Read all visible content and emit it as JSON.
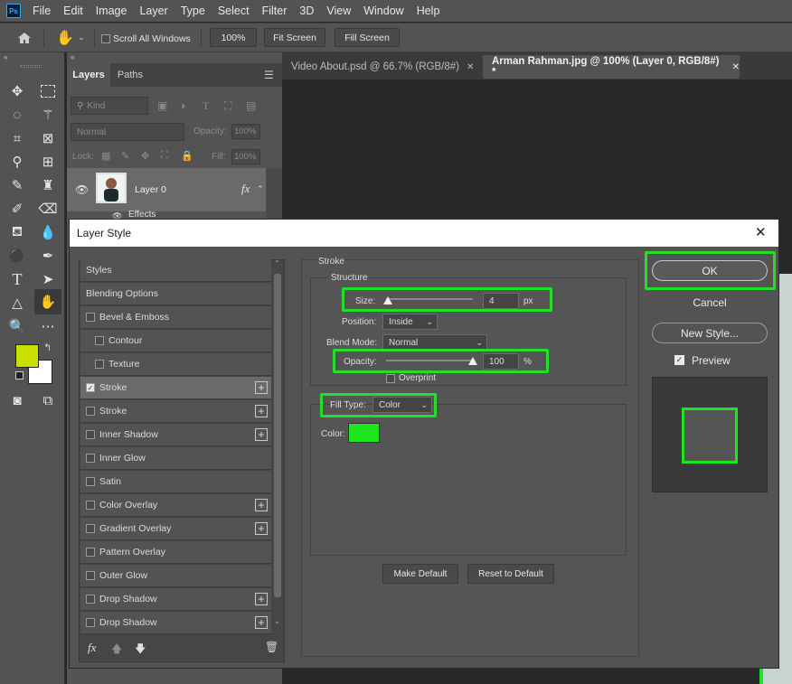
{
  "menu": {
    "items": [
      "File",
      "Edit",
      "Image",
      "Layer",
      "Type",
      "Select",
      "Filter",
      "3D",
      "View",
      "Window",
      "Help"
    ],
    "app_badge": "Ps"
  },
  "options": {
    "scroll_all": "Scroll All Windows",
    "zoom": "100%",
    "fit_screen": "Fit Screen",
    "fill_screen": "Fill Screen"
  },
  "tabs": [
    {
      "label": "Video About.psd @ 66.7% (RGB/8#)"
    },
    {
      "label": "Arman Rahman.jpg @ 100% (Layer 0, RGB/8#) *"
    }
  ],
  "layers": {
    "tab_layers": "Layers",
    "tab_paths": "Paths",
    "kind": "Kind",
    "blend": "Normal",
    "opacity_label": "Opacity:",
    "opacity": "100%",
    "lock_label": "Lock:",
    "fill_label": "Fill:",
    "fill": "100%",
    "layer_name": "Layer 0",
    "effects": "Effects",
    "fx": "fx"
  },
  "dialog": {
    "title": "Layer Style",
    "styles_list": [
      {
        "label": "Styles",
        "checkbox": false,
        "plus": false
      },
      {
        "label": "Blending Options",
        "checkbox": false,
        "plus": false
      },
      {
        "label": "Bevel & Emboss",
        "checkbox": true,
        "checked": false,
        "plus": false
      },
      {
        "label": "Contour",
        "checkbox": true,
        "checked": false,
        "plus": false,
        "indent": true
      },
      {
        "label": "Texture",
        "checkbox": true,
        "checked": false,
        "plus": false,
        "indent": true
      },
      {
        "label": "Stroke",
        "checkbox": true,
        "checked": true,
        "plus": true,
        "selected": true
      },
      {
        "label": "Stroke",
        "checkbox": true,
        "checked": false,
        "plus": true
      },
      {
        "label": "Inner Shadow",
        "checkbox": true,
        "checked": false,
        "plus": true
      },
      {
        "label": "Inner Glow",
        "checkbox": true,
        "checked": false,
        "plus": false
      },
      {
        "label": "Satin",
        "checkbox": true,
        "checked": false,
        "plus": false
      },
      {
        "label": "Color Overlay",
        "checkbox": true,
        "checked": false,
        "plus": true
      },
      {
        "label": "Gradient Overlay",
        "checkbox": true,
        "checked": false,
        "plus": true
      },
      {
        "label": "Pattern Overlay",
        "checkbox": true,
        "checked": false,
        "plus": false
      },
      {
        "label": "Outer Glow",
        "checkbox": true,
        "checked": false,
        "plus": false
      },
      {
        "label": "Drop Shadow",
        "checkbox": true,
        "checked": false,
        "plus": true
      },
      {
        "label": "Drop Shadow",
        "checkbox": true,
        "checked": false,
        "plus": true
      }
    ],
    "section": "Stroke",
    "structure": "Structure",
    "size_label": "Size:",
    "size_value": "4",
    "size_unit": "px",
    "size_fraction": 0.02,
    "position_label": "Position:",
    "position_value": "Inside",
    "blend_label": "Blend Mode:",
    "blend_value": "Normal",
    "opacity_label": "Opacity:",
    "opacity_value": "100",
    "opacity_unit": "%",
    "opacity_fraction": 1.0,
    "overprint": "Overprint",
    "filltype_label": "Fill Type:",
    "filltype_value": "Color",
    "color_label": "Color:",
    "stroke_color": "#1ee61e",
    "make_default": "Make Default",
    "reset_default": "Reset to Default",
    "ok": "OK",
    "cancel": "Cancel",
    "new_style": "New Style...",
    "preview": "Preview",
    "highlight_color": "#22e02a"
  }
}
